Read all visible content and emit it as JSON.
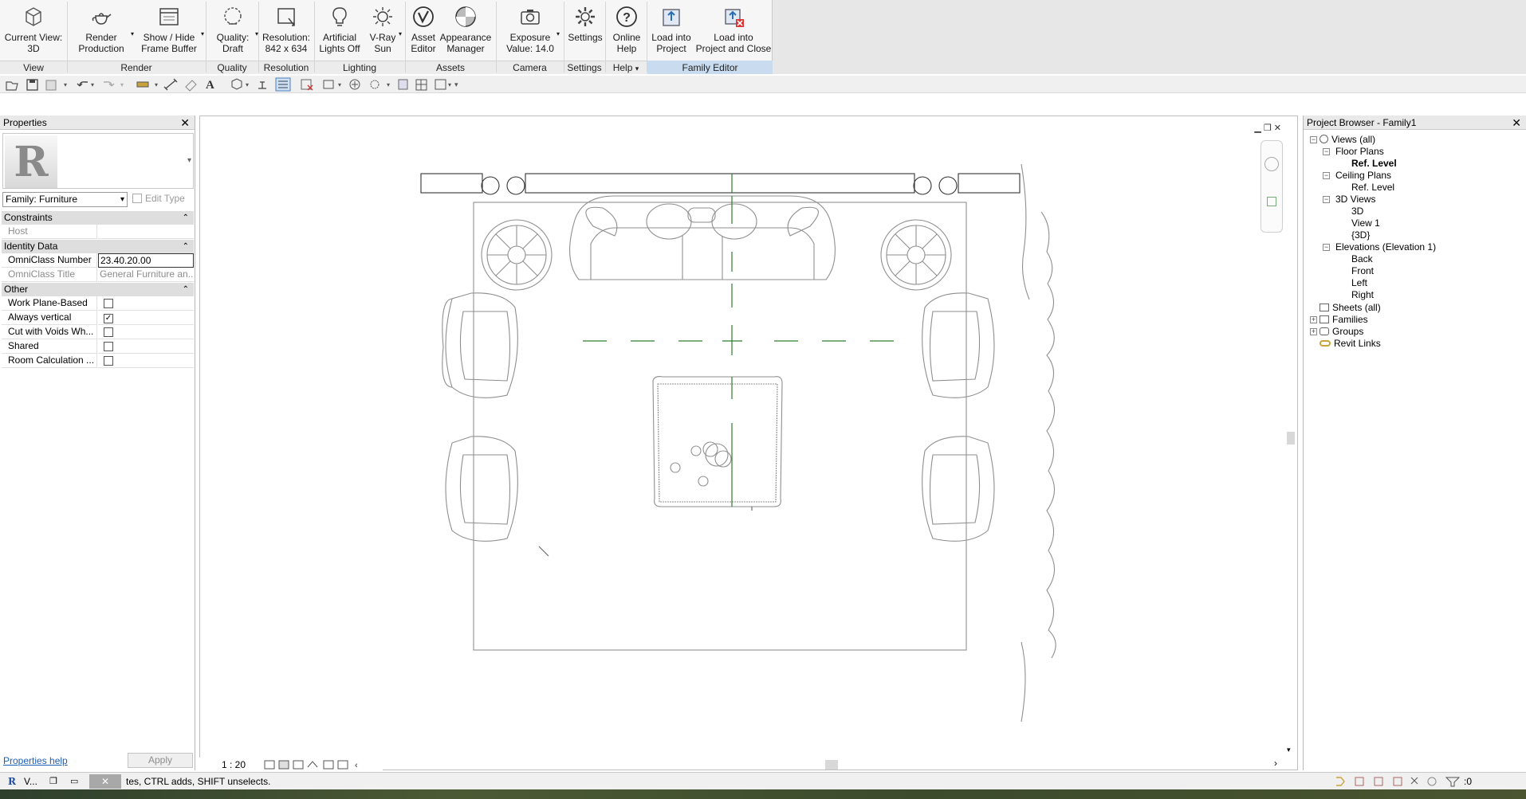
{
  "ribbon": {
    "buttons": [
      {
        "label": "Current View:\n3D",
        "icon": "cube-view-icon"
      },
      {
        "label": "Render\nProduction",
        "icon": "teapot-icon"
      },
      {
        "label": "Show / Hide\nFrame Buffer",
        "icon": "frame-buffer-icon"
      },
      {
        "label": "Quality:\nDraft",
        "icon": "quality-icon"
      },
      {
        "label": "Resolution:\n842 x 634",
        "icon": "resolution-icon"
      },
      {
        "label": "Artificial\nLights Off",
        "icon": "light-bulb-icon"
      },
      {
        "label": "V-Ray\nSun",
        "icon": "sun-icon"
      },
      {
        "label": "Asset\nEditor",
        "icon": "vray-asset-icon"
      },
      {
        "label": "Appearance\nManager",
        "icon": "appearance-sphere-icon"
      },
      {
        "label": "Exposure\nValue: 14.0",
        "icon": "camera-icon"
      },
      {
        "label": "Settings",
        "icon": "gear-icon"
      },
      {
        "label": "Online\nHelp",
        "icon": "help-icon"
      },
      {
        "label": "Load into\nProject",
        "icon": "load-project-icon"
      },
      {
        "label": "Load into\nProject and Close",
        "icon": "load-close-icon"
      }
    ],
    "groups": [
      "View",
      "Render",
      "Quality",
      "Resolution",
      "Lighting",
      "Assets",
      "Camera",
      "Settings",
      "Help",
      "Family Editor"
    ]
  },
  "properties": {
    "title": "Properties",
    "type_selector_arrow": "▾",
    "family_dropdown": "Family: Furniture",
    "edit_type": "Edit Type",
    "sections": {
      "constraints": "Constraints",
      "identity": "Identity Data",
      "other": "Other"
    },
    "rows": {
      "host": {
        "name": "Host",
        "value": ""
      },
      "omniclass_number": {
        "name": "OmniClass Number",
        "value": "23.40.20.00"
      },
      "omniclass_title": {
        "name": "OmniClass Title",
        "value": "General Furniture an..."
      },
      "work_plane": {
        "name": "Work Plane-Based",
        "checked": false
      },
      "always_vertical": {
        "name": "Always vertical",
        "checked": true
      },
      "cut_voids": {
        "name": "Cut with Voids Wh...",
        "checked": false
      },
      "shared": {
        "name": "Shared",
        "checked": false
      },
      "room_calc": {
        "name": "Room Calculation ...",
        "checked": false
      }
    },
    "help_link": "Properties help",
    "apply": "Apply"
  },
  "view": {
    "scale": "1 : 20"
  },
  "project_browser": {
    "title": "Project Browser - Family1",
    "tree": {
      "views_all": "Views (all)",
      "floor_plans": "Floor Plans",
      "ref_level_fp": "Ref. Level",
      "ceiling_plans": "Ceiling Plans",
      "ref_level_cp": "Ref. Level",
      "views_3d": "3D Views",
      "v3d": "3D",
      "view1": "View 1",
      "v3d_default": "{3D}",
      "elevations": "Elevations (Elevation 1)",
      "back": "Back",
      "front": "Front",
      "left": "Left",
      "right": "Right",
      "sheets": "Sheets (all)",
      "families": "Families",
      "groups": "Groups",
      "revit_links": "Revit Links"
    }
  },
  "status": {
    "app_label": "V...",
    "message": "tes, CTRL adds, SHIFT unselects.",
    "filter_count": ":0"
  },
  "colors": {
    "ribbon_bg": "#f6f6f6",
    "family_editor_group": "#c9dbef",
    "reference_plane": "#2d7d2d",
    "sketch_line": "#8f8f8f",
    "link": "#1a5fb4"
  }
}
